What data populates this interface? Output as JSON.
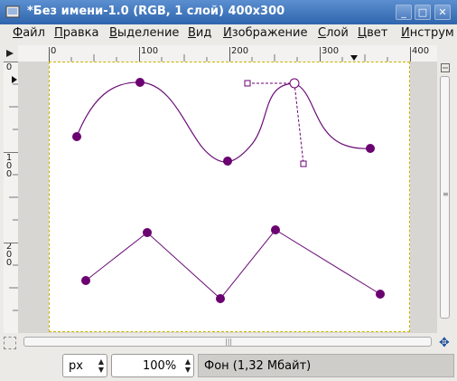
{
  "window": {
    "title": "*Без имени-1.0 (RGB, 1 слой) 400x300",
    "buttons": {
      "minimize": "_",
      "maximize": "□",
      "close": "✕"
    }
  },
  "menubar": {
    "items": [
      "Файл",
      "Правка",
      "Выделение",
      "Вид",
      "Изображение",
      "Слой",
      "Цвет",
      "Инструм"
    ]
  },
  "rulers": {
    "horizontal": [
      "0",
      "100",
      "200",
      "300",
      "400"
    ],
    "vertical": [
      "0",
      "100",
      "200"
    ]
  },
  "statusbar": {
    "unit": "px",
    "zoom": "100%",
    "message": "Фон (1,32 Мбайт)"
  },
  "colors": {
    "path": "#6b0d78",
    "point": "#6b0070",
    "canvas_border": "#c8b400"
  }
}
